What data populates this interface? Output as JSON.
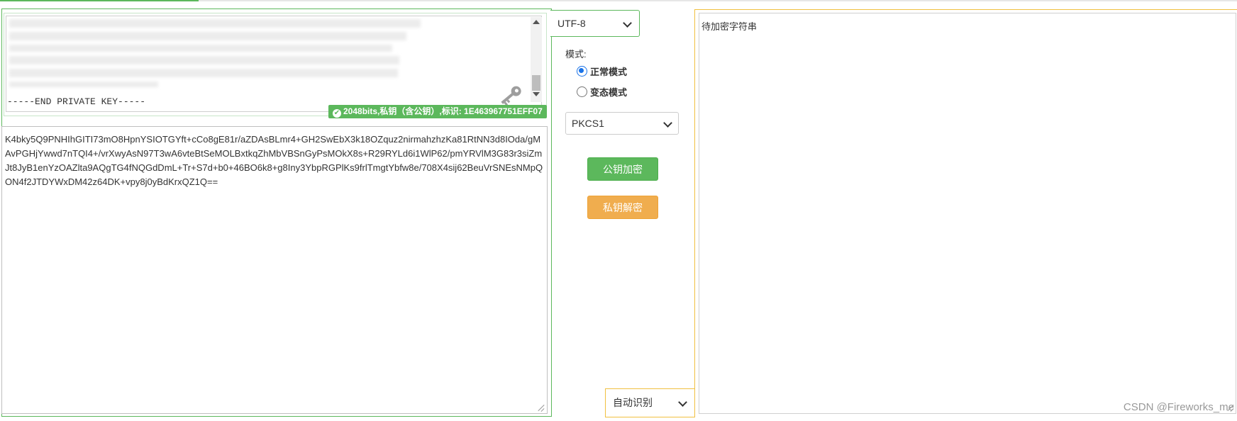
{
  "private_key_panel": {
    "end_line": "-----END PRIVATE KEY-----",
    "info_badge": "2048bits,私钥（含公钥）,标识: 1E463967751EFF07"
  },
  "cipher_text": "K4bky5Q9PNHIhGITI73mO8HpnYSIOTGYft+cCo8gE81r/aZDAsBLmr4+GH2SwEbX3k18OZquz2nirmahzhzKa81RtNN3d8IOda/gMAvPGHjYwwd7nTQI4+/vrXwyAsN97T3wA6vteBtSeMOLBxtkqZhMbVBSnGyPsMOkX8s+R29RYLd6i1WlP62/pmYRVlM3G83r3siZmJt8JyB1enYzOAZlta9AQgTG4fNQGdDmL+Tr+S7d+b0+46BO6k8+g8Iny3YbpRGPlKs9frlTmgtYbfw8e/708X4sij62BeuVrSNEsNMpQON4f2JTDYWxDM42z64DK+vpy8j0yBdKrxQZ1Q==",
  "controls": {
    "charset": "UTF-8",
    "mode_label": "模式:",
    "mode_normal": "正常模式",
    "mode_variant": "变态模式",
    "selected_mode": "normal",
    "padding": "PKCS1",
    "encrypt_button": "公钥加密",
    "decrypt_button": "私钥解密",
    "output_format": "自动识别"
  },
  "plain_text": "待加密字符串",
  "watermark": "CSDN @Fireworks_me",
  "colors": {
    "green": "#5cb85c",
    "orange": "#f0ad4e",
    "yellow_border": "#f0c040",
    "radio_blue": "#1a73e8"
  },
  "icons": [
    "key-icon",
    "check-circle-icon",
    "chevron-down-icon",
    "resize-grip-icon"
  ]
}
